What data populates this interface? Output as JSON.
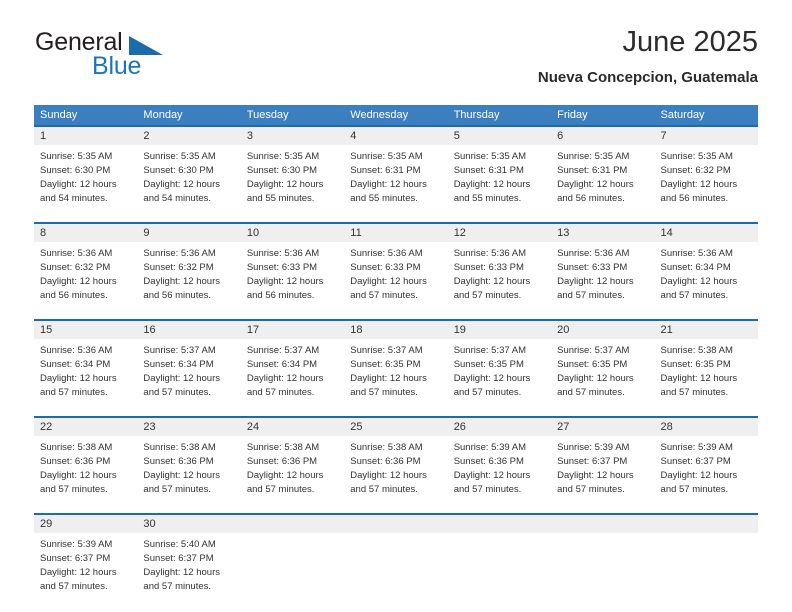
{
  "brand": {
    "name_top": "General",
    "name_bottom": "Blue",
    "triangle_icon": "blue-triangle-icon",
    "colors": {
      "general_text": "#231f20",
      "blue_text": "#1b75bb",
      "triangle": "#1b6cac"
    }
  },
  "header": {
    "title": "June 2025",
    "subtitle": "Nueva Concepcion, Guatemala"
  },
  "calendar": {
    "header_bg": "#3c7fc1",
    "week_divider": "#1b6cac",
    "day_number_bg": "#efefef",
    "weekdays": [
      "Sunday",
      "Monday",
      "Tuesday",
      "Wednesday",
      "Thursday",
      "Friday",
      "Saturday"
    ],
    "weeks": [
      [
        {
          "day": "1",
          "sunrise": "Sunrise: 5:35 AM",
          "sunset": "Sunset: 6:30 PM",
          "daylight_line1": "Daylight: 12 hours",
          "daylight_line2": "and 54 minutes."
        },
        {
          "day": "2",
          "sunrise": "Sunrise: 5:35 AM",
          "sunset": "Sunset: 6:30 PM",
          "daylight_line1": "Daylight: 12 hours",
          "daylight_line2": "and 54 minutes."
        },
        {
          "day": "3",
          "sunrise": "Sunrise: 5:35 AM",
          "sunset": "Sunset: 6:30 PM",
          "daylight_line1": "Daylight: 12 hours",
          "daylight_line2": "and 55 minutes."
        },
        {
          "day": "4",
          "sunrise": "Sunrise: 5:35 AM",
          "sunset": "Sunset: 6:31 PM",
          "daylight_line1": "Daylight: 12 hours",
          "daylight_line2": "and 55 minutes."
        },
        {
          "day": "5",
          "sunrise": "Sunrise: 5:35 AM",
          "sunset": "Sunset: 6:31 PM",
          "daylight_line1": "Daylight: 12 hours",
          "daylight_line2": "and 55 minutes."
        },
        {
          "day": "6",
          "sunrise": "Sunrise: 5:35 AM",
          "sunset": "Sunset: 6:31 PM",
          "daylight_line1": "Daylight: 12 hours",
          "daylight_line2": "and 56 minutes."
        },
        {
          "day": "7",
          "sunrise": "Sunrise: 5:35 AM",
          "sunset": "Sunset: 6:32 PM",
          "daylight_line1": "Daylight: 12 hours",
          "daylight_line2": "and 56 minutes."
        }
      ],
      [
        {
          "day": "8",
          "sunrise": "Sunrise: 5:36 AM",
          "sunset": "Sunset: 6:32 PM",
          "daylight_line1": "Daylight: 12 hours",
          "daylight_line2": "and 56 minutes."
        },
        {
          "day": "9",
          "sunrise": "Sunrise: 5:36 AM",
          "sunset": "Sunset: 6:32 PM",
          "daylight_line1": "Daylight: 12 hours",
          "daylight_line2": "and 56 minutes."
        },
        {
          "day": "10",
          "sunrise": "Sunrise: 5:36 AM",
          "sunset": "Sunset: 6:33 PM",
          "daylight_line1": "Daylight: 12 hours",
          "daylight_line2": "and 56 minutes."
        },
        {
          "day": "11",
          "sunrise": "Sunrise: 5:36 AM",
          "sunset": "Sunset: 6:33 PM",
          "daylight_line1": "Daylight: 12 hours",
          "daylight_line2": "and 57 minutes."
        },
        {
          "day": "12",
          "sunrise": "Sunrise: 5:36 AM",
          "sunset": "Sunset: 6:33 PM",
          "daylight_line1": "Daylight: 12 hours",
          "daylight_line2": "and 57 minutes."
        },
        {
          "day": "13",
          "sunrise": "Sunrise: 5:36 AM",
          "sunset": "Sunset: 6:33 PM",
          "daylight_line1": "Daylight: 12 hours",
          "daylight_line2": "and 57 minutes."
        },
        {
          "day": "14",
          "sunrise": "Sunrise: 5:36 AM",
          "sunset": "Sunset: 6:34 PM",
          "daylight_line1": "Daylight: 12 hours",
          "daylight_line2": "and 57 minutes."
        }
      ],
      [
        {
          "day": "15",
          "sunrise": "Sunrise: 5:36 AM",
          "sunset": "Sunset: 6:34 PM",
          "daylight_line1": "Daylight: 12 hours",
          "daylight_line2": "and 57 minutes."
        },
        {
          "day": "16",
          "sunrise": "Sunrise: 5:37 AM",
          "sunset": "Sunset: 6:34 PM",
          "daylight_line1": "Daylight: 12 hours",
          "daylight_line2": "and 57 minutes."
        },
        {
          "day": "17",
          "sunrise": "Sunrise: 5:37 AM",
          "sunset": "Sunset: 6:34 PM",
          "daylight_line1": "Daylight: 12 hours",
          "daylight_line2": "and 57 minutes."
        },
        {
          "day": "18",
          "sunrise": "Sunrise: 5:37 AM",
          "sunset": "Sunset: 6:35 PM",
          "daylight_line1": "Daylight: 12 hours",
          "daylight_line2": "and 57 minutes."
        },
        {
          "day": "19",
          "sunrise": "Sunrise: 5:37 AM",
          "sunset": "Sunset: 6:35 PM",
          "daylight_line1": "Daylight: 12 hours",
          "daylight_line2": "and 57 minutes."
        },
        {
          "day": "20",
          "sunrise": "Sunrise: 5:37 AM",
          "sunset": "Sunset: 6:35 PM",
          "daylight_line1": "Daylight: 12 hours",
          "daylight_line2": "and 57 minutes."
        },
        {
          "day": "21",
          "sunrise": "Sunrise: 5:38 AM",
          "sunset": "Sunset: 6:35 PM",
          "daylight_line1": "Daylight: 12 hours",
          "daylight_line2": "and 57 minutes."
        }
      ],
      [
        {
          "day": "22",
          "sunrise": "Sunrise: 5:38 AM",
          "sunset": "Sunset: 6:36 PM",
          "daylight_line1": "Daylight: 12 hours",
          "daylight_line2": "and 57 minutes."
        },
        {
          "day": "23",
          "sunrise": "Sunrise: 5:38 AM",
          "sunset": "Sunset: 6:36 PM",
          "daylight_line1": "Daylight: 12 hours",
          "daylight_line2": "and 57 minutes."
        },
        {
          "day": "24",
          "sunrise": "Sunrise: 5:38 AM",
          "sunset": "Sunset: 6:36 PM",
          "daylight_line1": "Daylight: 12 hours",
          "daylight_line2": "and 57 minutes."
        },
        {
          "day": "25",
          "sunrise": "Sunrise: 5:38 AM",
          "sunset": "Sunset: 6:36 PM",
          "daylight_line1": "Daylight: 12 hours",
          "daylight_line2": "and 57 minutes."
        },
        {
          "day": "26",
          "sunrise": "Sunrise: 5:39 AM",
          "sunset": "Sunset: 6:36 PM",
          "daylight_line1": "Daylight: 12 hours",
          "daylight_line2": "and 57 minutes."
        },
        {
          "day": "27",
          "sunrise": "Sunrise: 5:39 AM",
          "sunset": "Sunset: 6:37 PM",
          "daylight_line1": "Daylight: 12 hours",
          "daylight_line2": "and 57 minutes."
        },
        {
          "day": "28",
          "sunrise": "Sunrise: 5:39 AM",
          "sunset": "Sunset: 6:37 PM",
          "daylight_line1": "Daylight: 12 hours",
          "daylight_line2": "and 57 minutes."
        }
      ],
      [
        {
          "day": "29",
          "sunrise": "Sunrise: 5:39 AM",
          "sunset": "Sunset: 6:37 PM",
          "daylight_line1": "Daylight: 12 hours",
          "daylight_line2": "and 57 minutes."
        },
        {
          "day": "30",
          "sunrise": "Sunrise: 5:40 AM",
          "sunset": "Sunset: 6:37 PM",
          "daylight_line1": "Daylight: 12 hours",
          "daylight_line2": "and 57 minutes."
        },
        {
          "day": "",
          "sunrise": "",
          "sunset": "",
          "daylight_line1": "",
          "daylight_line2": ""
        },
        {
          "day": "",
          "sunrise": "",
          "sunset": "",
          "daylight_line1": "",
          "daylight_line2": ""
        },
        {
          "day": "",
          "sunrise": "",
          "sunset": "",
          "daylight_line1": "",
          "daylight_line2": ""
        },
        {
          "day": "",
          "sunrise": "",
          "sunset": "",
          "daylight_line1": "",
          "daylight_line2": ""
        },
        {
          "day": "",
          "sunrise": "",
          "sunset": "",
          "daylight_line1": "",
          "daylight_line2": ""
        }
      ]
    ]
  }
}
